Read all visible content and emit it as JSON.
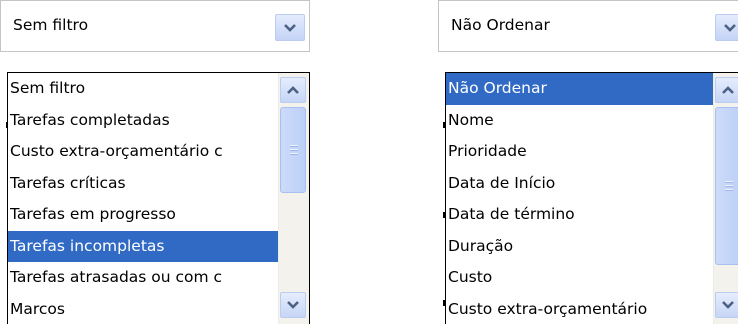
{
  "filter": {
    "selected_value": "Sem filtro",
    "items": [
      {
        "label": "Sem filtro",
        "selected": false
      },
      {
        "label": "Tarefas completadas",
        "selected": false
      },
      {
        "label": "Custo extra-orçamentário c",
        "selected": false
      },
      {
        "label": "Tarefas críticas",
        "selected": false
      },
      {
        "label": "Tarefas em progresso",
        "selected": false
      },
      {
        "label": "Tarefas incompletas",
        "selected": true
      },
      {
        "label": "Tarefas atrasadas ou com c",
        "selected": false
      },
      {
        "label": "Marcos",
        "selected": false
      }
    ]
  },
  "sort": {
    "selected_value": "Não Ordenar",
    "items": [
      {
        "label": "Não Ordenar",
        "selected": true
      },
      {
        "label": "Nome",
        "selected": false
      },
      {
        "label": "Prioridade",
        "selected": false
      },
      {
        "label": "Data de Início",
        "selected": false
      },
      {
        "label": "Data de término",
        "selected": false
      },
      {
        "label": "Duração",
        "selected": false
      },
      {
        "label": "Custo",
        "selected": false
      },
      {
        "label": "Custo extra-orçamentário",
        "selected": false
      }
    ]
  },
  "colors": {
    "selection": "#316ac5",
    "arrow": "#4d6185"
  },
  "icons": [
    "chevron-down-icon",
    "chevron-up-icon",
    "scroll-grip-icon"
  ]
}
